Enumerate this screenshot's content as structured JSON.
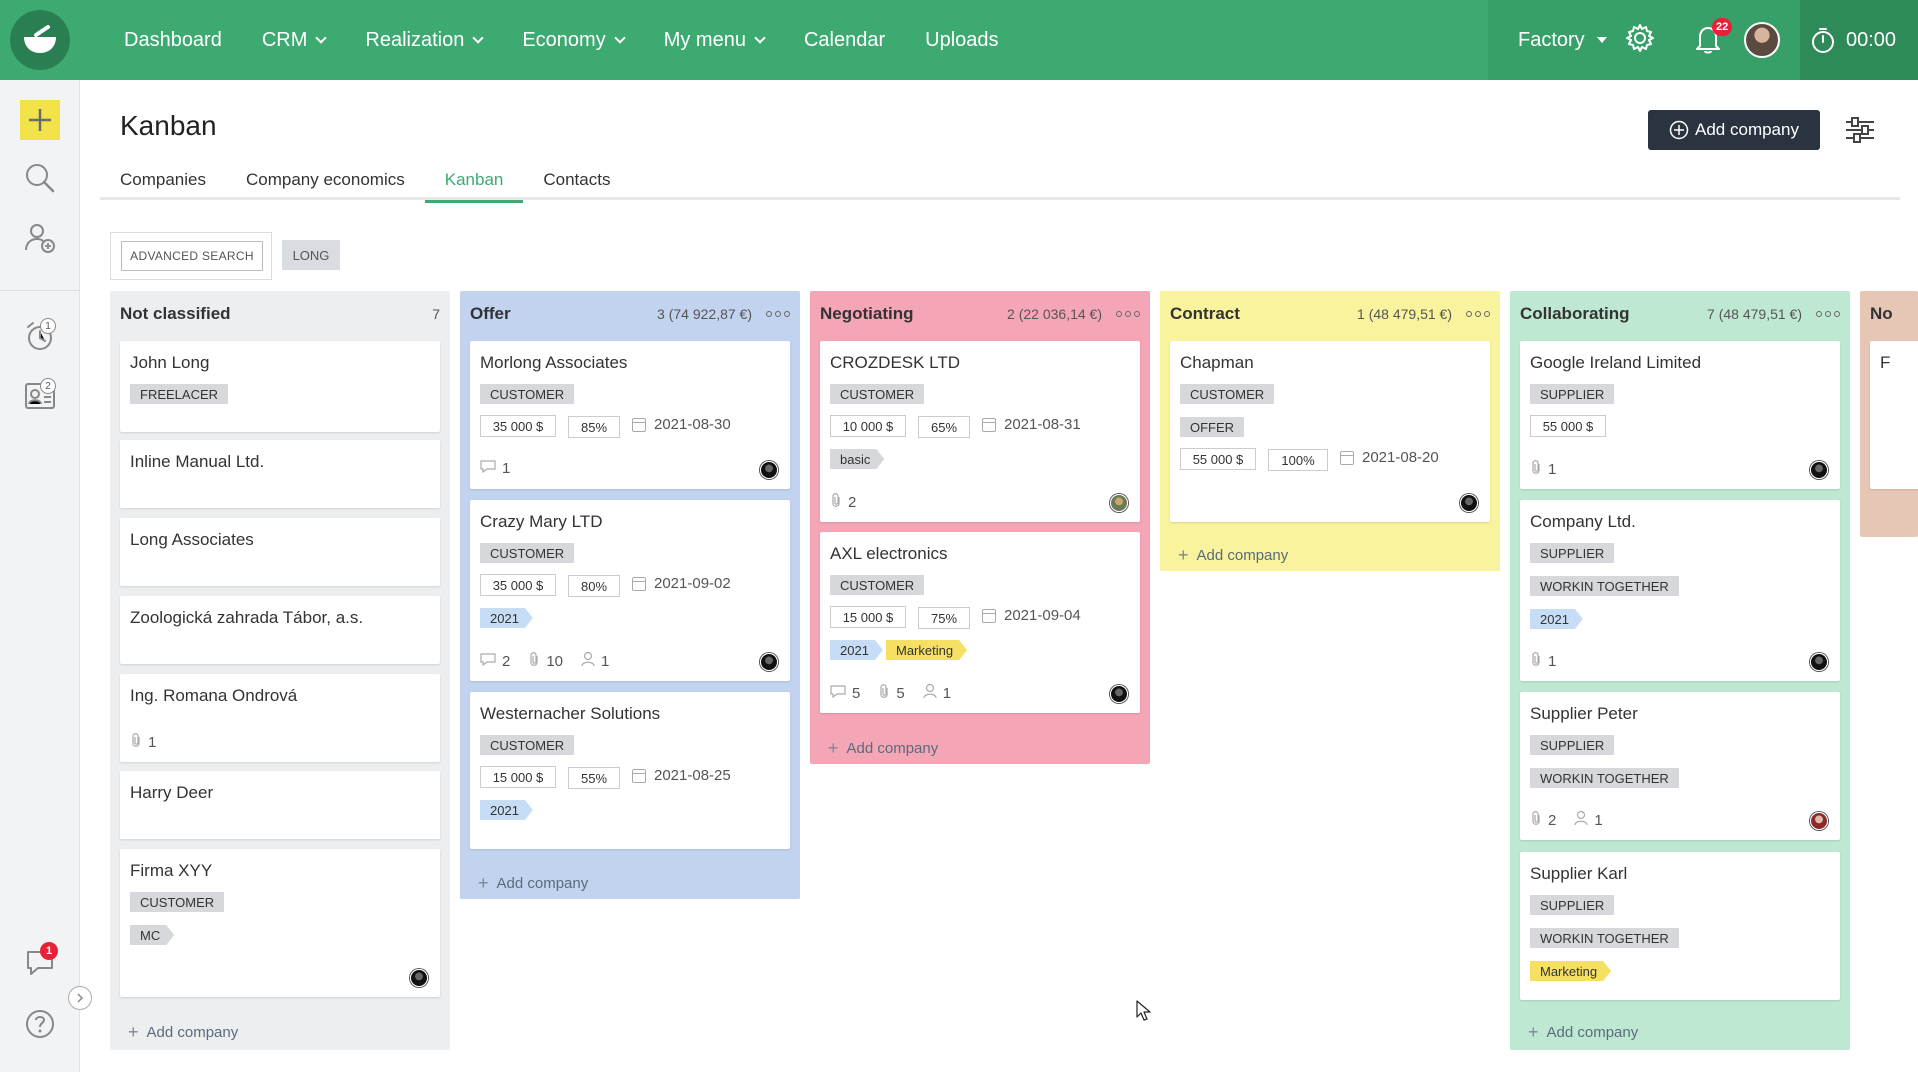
{
  "nav": {
    "items": [
      {
        "label": "Dashboard",
        "caret": false
      },
      {
        "label": "CRM",
        "caret": true
      },
      {
        "label": "Realization",
        "caret": true
      },
      {
        "label": "Economy",
        "caret": true
      },
      {
        "label": "My menu",
        "caret": true
      },
      {
        "label": "Calendar",
        "caret": false
      },
      {
        "label": "Uploads",
        "caret": false
      }
    ],
    "factory": "Factory",
    "notifications": "22",
    "timer": "00:00"
  },
  "sidebar": {
    "alarm_badge": "1",
    "contacts_badge": "2",
    "chat_badge": "1"
  },
  "page": {
    "title": "Kanban",
    "add_company": "Add company",
    "tabs": [
      "Companies",
      "Company economics",
      "Kanban",
      "Contacts"
    ],
    "active_tab": "Kanban",
    "advanced_search": "ADVANCED SEARCH",
    "filter_tag": "LONG"
  },
  "add_label": "Add company",
  "columns": [
    {
      "title": "Not classified",
      "meta": "7",
      "color": "#eceef0",
      "cards": [
        {
          "name": "John Long",
          "tags": [
            "FREELACER"
          ]
        },
        {
          "name": "Inline Manual Ltd."
        },
        {
          "name": "Long Associates"
        },
        {
          "name": "Zoologická zahrada Tábor, a.s."
        },
        {
          "name": "Ing. Romana Ondrová",
          "attachments": "1"
        },
        {
          "name": "Harry Deer"
        },
        {
          "name": "Firma XYY",
          "tags": [
            "CUSTOMER"
          ],
          "extra_tag": "MC"
        }
      ]
    },
    {
      "title": "Offer",
      "meta": "3 (74 922,87 €)",
      "color": "#c2d3f0",
      "cards": [
        {
          "name": "Morlong Associates",
          "tags": [
            "CUSTOMER"
          ],
          "amount": "35 000 $",
          "percent": "85%",
          "date": "2021-08-30",
          "comments": "1"
        },
        {
          "name": "Crazy Mary LTD",
          "tags": [
            "CUSTOMER"
          ],
          "amount": "35 000 $",
          "percent": "80%",
          "date": "2021-09-02",
          "year": "2021",
          "comments": "2",
          "attachments": "10",
          "people": "1"
        },
        {
          "name": "Westernacher Solutions",
          "tags": [
            "CUSTOMER"
          ],
          "amount": "15 000 $",
          "percent": "55%",
          "date": "2021-08-25",
          "year": "2021"
        }
      ]
    },
    {
      "title": "Negotiating",
      "meta": "2 (22 036,14 €)",
      "color": "#f4a6b6",
      "cards": [
        {
          "name": "CROZDESK LTD",
          "tags": [
            "CUSTOMER"
          ],
          "amount": "10 000 $",
          "percent": "65%",
          "date": "2021-08-31",
          "label": "basic",
          "attachments": "2"
        },
        {
          "name": "AXL electronics",
          "tags": [
            "CUSTOMER"
          ],
          "amount": "15 000 $",
          "percent": "75%",
          "date": "2021-09-04",
          "year": "2021",
          "label": "Marketing",
          "comments": "5",
          "attachments": "5",
          "people": "1"
        }
      ]
    },
    {
      "title": "Contract",
      "meta": "1 (48 479,51 €)",
      "color": "#f8f39c",
      "cards": [
        {
          "name": "Chapman",
          "tags": [
            "CUSTOMER",
            "OFFER"
          ],
          "amount": "55 000 $",
          "percent": "100%",
          "date": "2021-08-20"
        }
      ]
    },
    {
      "title": "Collaborating",
      "meta": "7 (48 479,51 €)",
      "color": "#bfe8d2",
      "cards": [
        {
          "name": "Google Ireland Limited",
          "tags": [
            "SUPPLIER"
          ],
          "amount": "55 000 $",
          "attachments": "1"
        },
        {
          "name": "Company Ltd.",
          "tags": [
            "SUPPLIER",
            "WORKIN TOGETHER"
          ],
          "year": "2021",
          "attachments": "1"
        },
        {
          "name": "Supplier Peter",
          "tags": [
            "SUPPLIER",
            "WORKIN TOGETHER"
          ],
          "attachments": "2",
          "people": "1"
        },
        {
          "name": "Supplier Karl",
          "tags": [
            "SUPPLIER",
            "WORKIN TOGETHER"
          ],
          "label": "Marketing"
        }
      ]
    },
    {
      "title": "No",
      "meta": "",
      "color": "#e6c6b4",
      "cards": [
        {
          "name": "F"
        }
      ]
    }
  ]
}
